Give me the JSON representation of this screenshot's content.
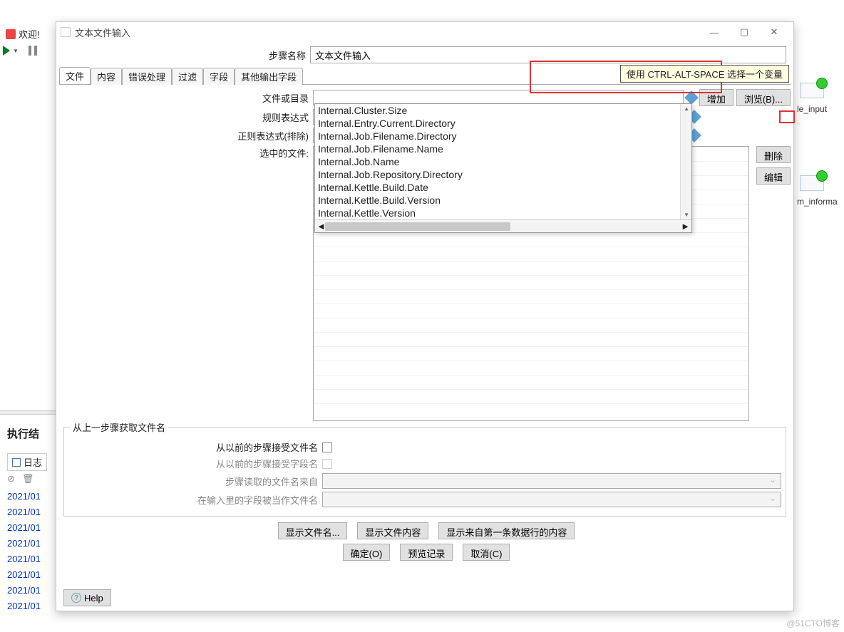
{
  "background": {
    "welcome_label": "欢迎!",
    "exec_results": "执行结",
    "log_tab": "日志",
    "timestamps": [
      "2021/01",
      "2021/01",
      "2021/01",
      "2021/01",
      "2021/01",
      "2021/01",
      "2021/01",
      "2021/01"
    ],
    "right_label_1": "le_input",
    "right_label_2": "m_informa"
  },
  "modal": {
    "title": "文本文件输入",
    "step_name_label": "步骤名称",
    "step_name_value": "文本文件输入",
    "tabs": [
      "文件",
      "内容",
      "错误处理",
      "过滤",
      "字段",
      "其他输出字段"
    ],
    "tooltip": "使用 CTRL-ALT-SPACE 选择一个变量",
    "file_or_dir_label": "文件或目录",
    "add_button": "增加",
    "browse_button": "浏览(B)...",
    "regex_label": "规则表达式",
    "regex_exclude_label": "正则表达式(排除)",
    "selected_files_label": "选中的文件:",
    "delete_button": "删除",
    "edit_button": "编辑",
    "dropdown_items": [
      "Internal.Cluster.Size",
      "Internal.Entry.Current.Directory",
      "Internal.Job.Filename.Directory",
      "Internal.Job.Filename.Name",
      "Internal.Job.Name",
      "Internal.Job.Repository.Directory",
      "Internal.Kettle.Build.Date",
      "Internal.Kettle.Build.Version",
      "Internal.Kettle.Version"
    ],
    "prev_step_group": {
      "legend": "从上一步骤获取文件名",
      "accept_filenames": "从以前的步骤接受文件名",
      "accept_fieldnames": "从以前的步骤接受字段名",
      "source_step": "步骤读取的文件名来自",
      "field_as_filename": "在输入里的字段被当作文件名"
    },
    "show_filenames": "显示文件名...",
    "show_content": "显示文件内容",
    "show_first_row": "显示来自第一条数据行的内容",
    "ok": "确定(O)",
    "preview": "预览记录",
    "cancel": "取消(C)",
    "help": "Help"
  },
  "watermark": "@51CTO博客"
}
